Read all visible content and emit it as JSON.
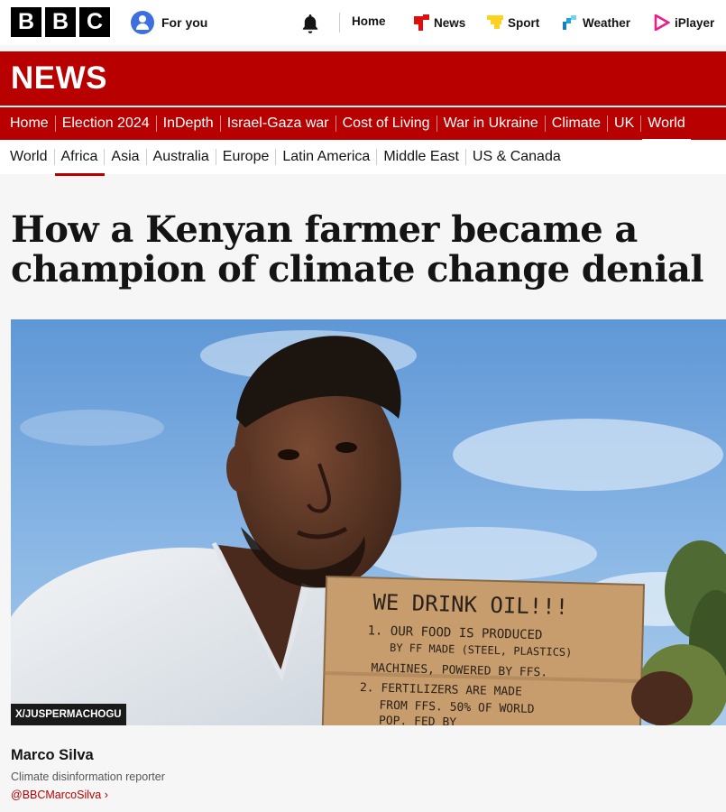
{
  "brand": {
    "logo_letters": [
      "B",
      "B",
      "C"
    ],
    "accent": "#b80000"
  },
  "topbar": {
    "for_you": "For you",
    "links": [
      {
        "label": "Home",
        "icon": "none"
      },
      {
        "label": "News",
        "icon": "news-icon"
      },
      {
        "label": "Sport",
        "icon": "sport-icon"
      },
      {
        "label": "Weather",
        "icon": "weather-icon"
      },
      {
        "label": "iPlayer",
        "icon": "iplayer-icon"
      }
    ]
  },
  "banner": {
    "title": "NEWS"
  },
  "section_nav": [
    "Home",
    "Election 2024",
    "InDepth",
    "Israel-Gaza war",
    "Cost of Living",
    "War in Ukraine",
    "Climate",
    "UK",
    "World"
  ],
  "section_nav_active": "World",
  "sub_nav": [
    "World",
    "Africa",
    "Asia",
    "Australia",
    "Europe",
    "Latin America",
    "Middle East",
    "US & Canada"
  ],
  "sub_nav_active": "Africa",
  "article": {
    "headline": "How a Kenyan farmer became a champion of climate change denial",
    "image_credit": "X/JUSPERMACHOGU",
    "sign_lines": [
      "WE DRINK OIL!!!",
      "1. OUR FOOD IS PRODUCED",
      "BY FF MADE (STEEL, PLASTICS)",
      "MACHINES, POWERED BY FFS.",
      "2. FERTILIZERS ARE MADE",
      "FROM FFS. 50% OF WORLD",
      "POP. FED BY"
    ],
    "author": "Marco Silva",
    "role": "Climate disinformation reporter",
    "handle": "@BBCMarcoSilva"
  }
}
